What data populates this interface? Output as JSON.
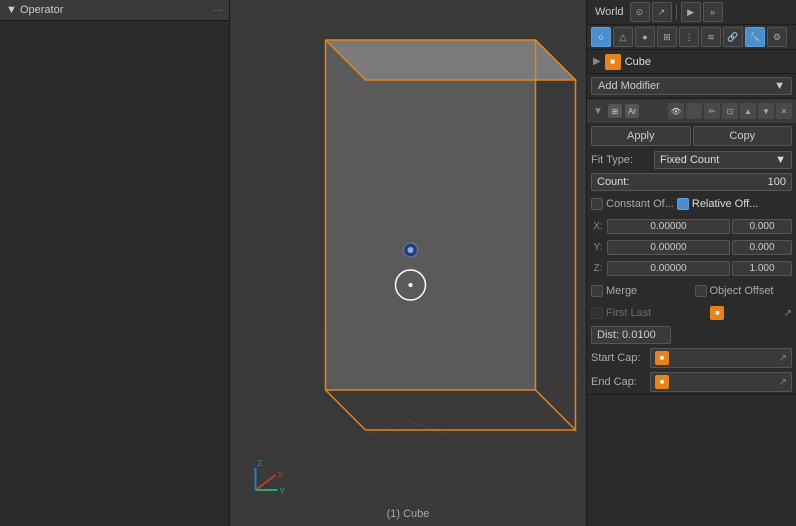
{
  "left_panel": {
    "title": "▼ Operator",
    "dots": "···"
  },
  "right_panel": {
    "top_bar": {
      "world_label": "World"
    },
    "object_name_row": {
      "arrow": "▶",
      "name": "Cube"
    },
    "add_modifier": {
      "label": "Add Modifier",
      "dropdown_arrow": "▼"
    },
    "modifier": {
      "header_icons": [
        "Ar",
        "👁",
        "🔒",
        "↑",
        "↓",
        "✕"
      ],
      "apply_label": "Apply",
      "copy_label": "Copy",
      "fit_type_label": "Fit Type:",
      "fit_type_value": "Fixed Count",
      "count_label": "Count:",
      "count_value": "100",
      "constant_offset_label": "Constant Of...",
      "relative_offset_label": "Relative Off...",
      "relative_offset_checked": true,
      "x_label": "X:",
      "x_left_value": "0.00000",
      "x_right_value": "0.000",
      "y_label": "Y:",
      "y_left_value": "0.00000",
      "y_right_value": "0.000",
      "z_label": "Z:",
      "z_left_value": "0.00000",
      "z_right_value": "1.000",
      "merge_label": "Merge",
      "object_offset_label": "Object Offset",
      "first_last_label": "First Last",
      "dist_value": "Dist: 0.0100",
      "start_cap_label": "Start Cap:",
      "end_cap_label": "End Cap:"
    }
  },
  "viewport": {
    "bottom_label": "(1) Cube"
  }
}
